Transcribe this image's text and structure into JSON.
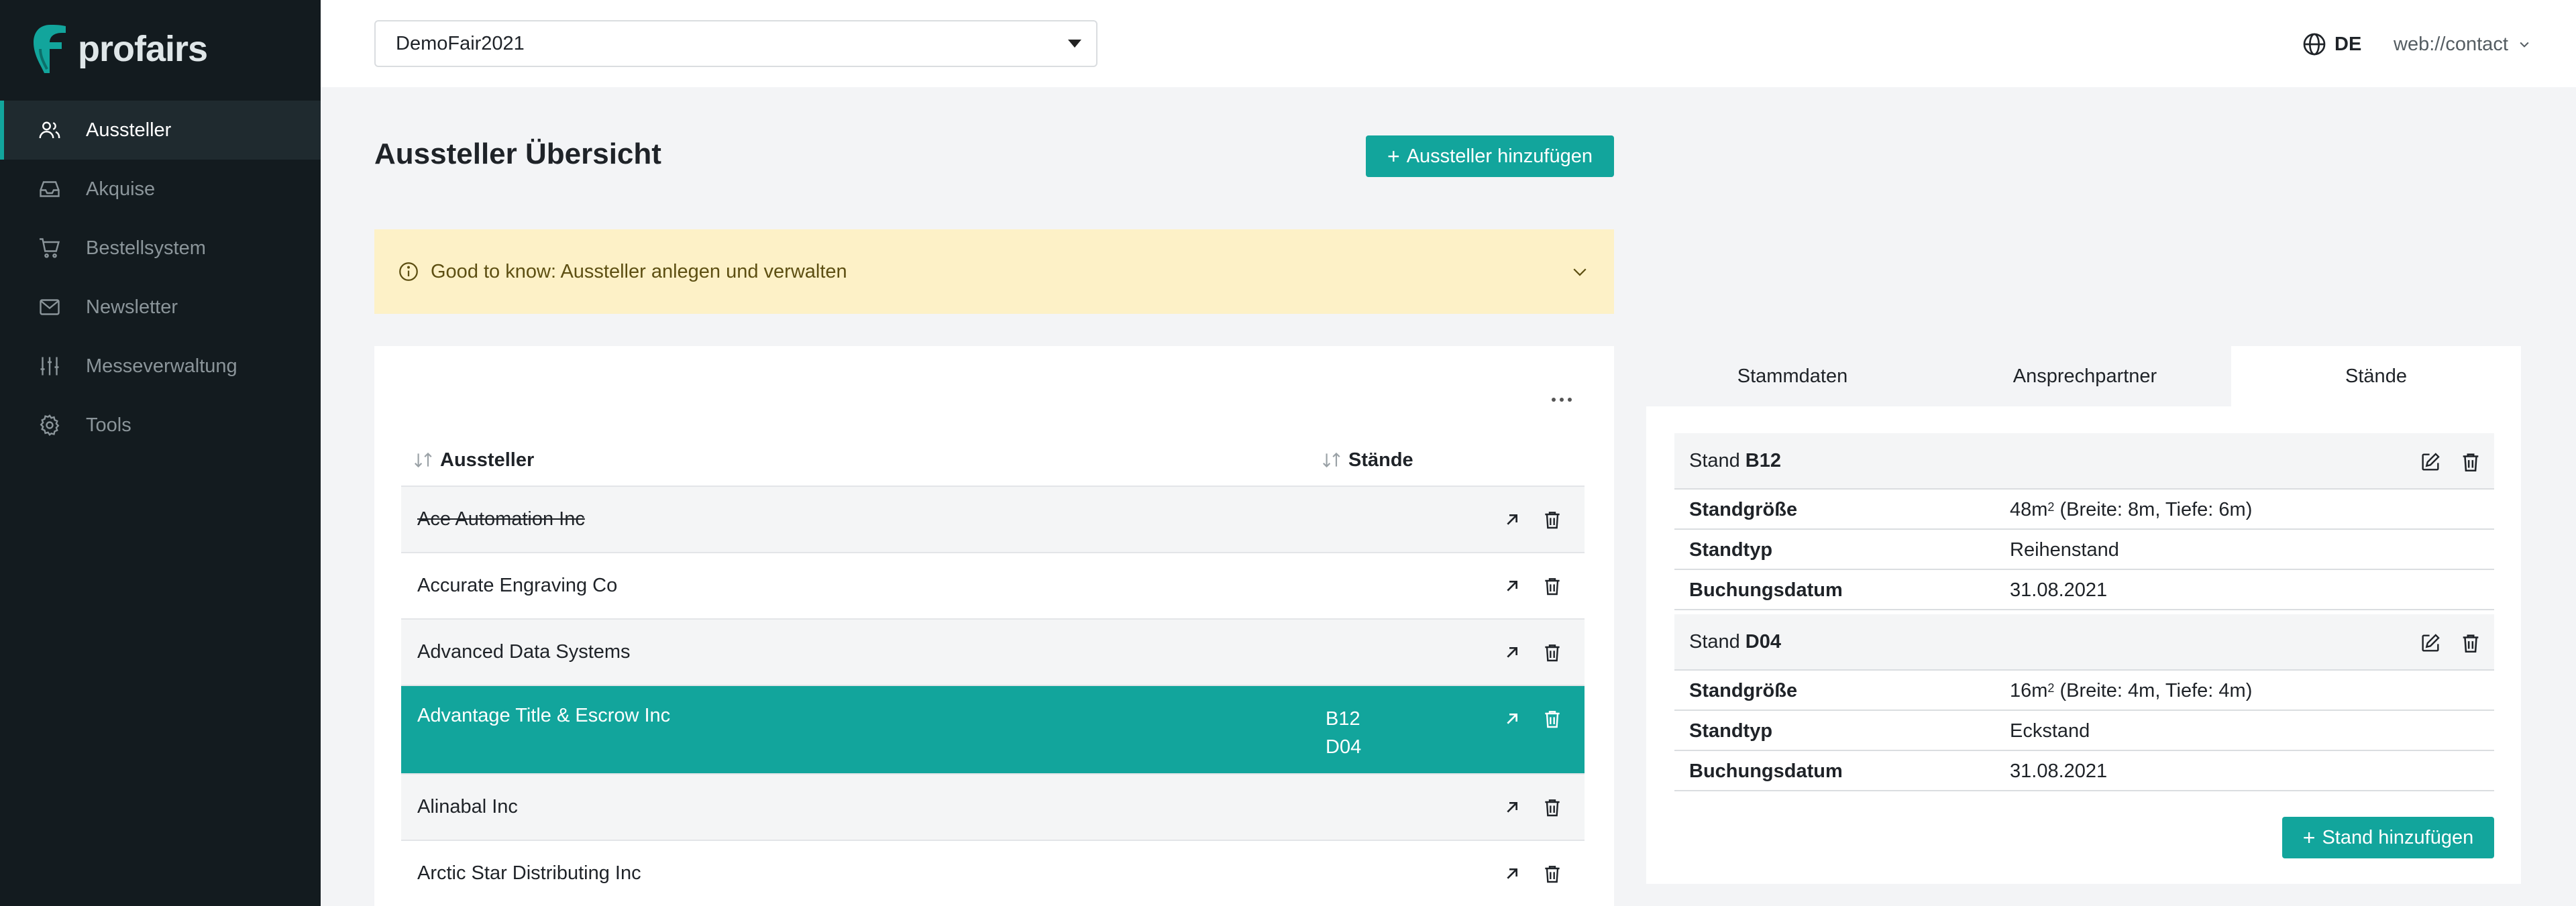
{
  "brand": {
    "name": "profairs",
    "accent": "#12a59c",
    "sidebar_bg": "#131b1f"
  },
  "sidebar": {
    "items": [
      {
        "label": "Aussteller",
        "icon": "users-icon",
        "active": true
      },
      {
        "label": "Akquise",
        "icon": "inbox-icon",
        "active": false
      },
      {
        "label": "Bestellsystem",
        "icon": "cart-icon",
        "active": false
      },
      {
        "label": "Newsletter",
        "icon": "mail-icon",
        "active": false
      },
      {
        "label": "Messeverwaltung",
        "icon": "sliders-icon",
        "active": false
      },
      {
        "label": "Tools",
        "icon": "gear-icon",
        "active": false
      }
    ]
  },
  "topbar": {
    "fair_select": {
      "value": "DemoFair2021"
    },
    "language": "DE",
    "user": "web://contact"
  },
  "main": {
    "title": "Aussteller Übersicht",
    "add_button": "Aussteller hinzufügen",
    "info_banner": "Good to know: Aussteller anlegen und verwalten",
    "table": {
      "columns": [
        "Aussteller",
        "Stände"
      ],
      "rows": [
        {
          "name": "Ace Automation Inc",
          "stands": "",
          "struck": true
        },
        {
          "name": "Accurate Engraving Co",
          "stands": ""
        },
        {
          "name": "Advanced Data Systems",
          "stands": ""
        },
        {
          "name": "Advantage Title & Escrow Inc",
          "stands_1": "B12",
          "stands_2": "D04",
          "selected": true
        },
        {
          "name": "Alinabal Inc",
          "stands": ""
        },
        {
          "name": "Arctic Star Distributing Inc",
          "stands": ""
        }
      ]
    }
  },
  "detail": {
    "tabs": [
      "Stammdaten",
      "Ansprechpartner",
      "Stände"
    ],
    "active_tab": "Stände",
    "stand_prefix": "Stand",
    "stands": [
      {
        "id": "B12",
        "size_label": "Standgröße",
        "size_value": "48m",
        "size_exp": "2",
        "size_detail": "(Breite: 8m, Tiefe: 6m)",
        "type_label": "Standtyp",
        "type_value": "Reihenstand",
        "date_label": "Buchungsdatum",
        "date_value": "31.08.2021"
      },
      {
        "id": "D04",
        "size_label": "Standgröße",
        "size_value": "16m",
        "size_exp": "2",
        "size_detail": "(Breite: 4m, Tiefe: 4m)",
        "type_label": "Standtyp",
        "type_value": "Eckstand",
        "date_label": "Buchungsdatum",
        "date_value": "31.08.2021"
      }
    ],
    "add_stand_button": "Stand hinzufügen"
  }
}
